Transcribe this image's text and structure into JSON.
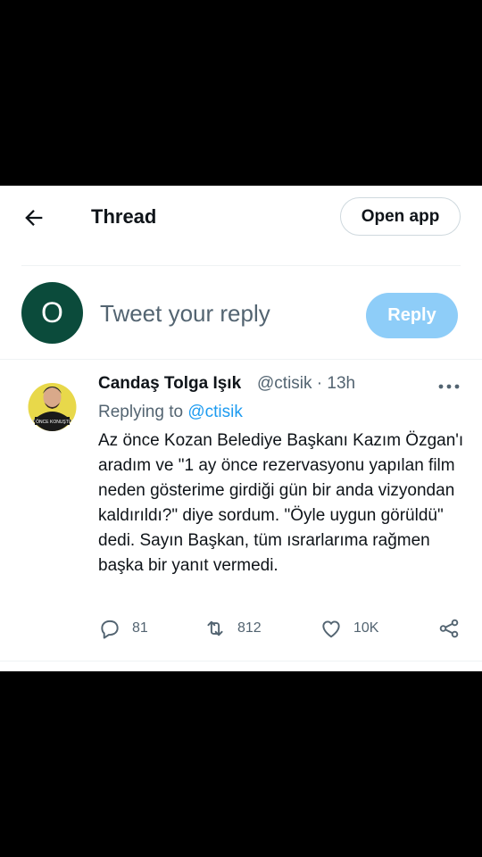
{
  "header": {
    "title": "Thread",
    "open_app_label": "Open app",
    "back_icon": "arrow-left-icon"
  },
  "composer": {
    "avatar_letter": "O",
    "placeholder": "Tweet your reply",
    "reply_label": "Reply",
    "avatar_color": "#0b4b3b",
    "reply_button_color": "#8ecdf8"
  },
  "tweet": {
    "author_name": "Candaş Tolga Işık",
    "author_handle": "@ctisik",
    "separator": "·",
    "time": "13h",
    "replying_label": "Replying to",
    "replying_handle": "@ctisik",
    "body": "Az önce Kozan Belediye Başkanı Kazım Özgan'ı aradım ve \"1 ay önce rezervasyonu yapılan film neden gösterime girdiği gün bir anda vizyondan kaldırıldı?\" diye sordum. \"Öyle uygun görüldü\" dedi. Sayın Başkan, tüm ısrarlarıma rağmen başka bir yanıt vermedi.",
    "avatar_logo_text": "AZ ÖNCE KONUŞTUM",
    "actions": {
      "replies": "81",
      "retweets": "812",
      "likes": "10K"
    }
  },
  "colors": {
    "link": "#1d9bf0",
    "secondary_text": "#536471",
    "primary_text": "#0f1419"
  }
}
